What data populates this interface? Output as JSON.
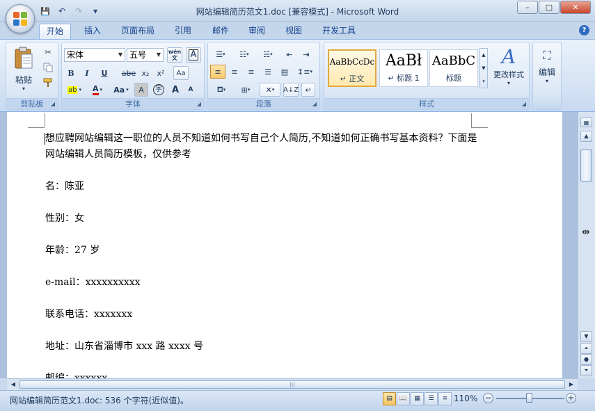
{
  "window": {
    "title": "网站编辑简历范文1.doc [兼容模式] - Microsoft Word",
    "minimize": "–",
    "maximize": "□",
    "close": "✕"
  },
  "qat": {
    "save": "💾",
    "undo": "↶",
    "redo": "↷",
    "customize": "▾"
  },
  "tabs": [
    "开始",
    "插入",
    "页面布局",
    "引用",
    "邮件",
    "审阅",
    "视图",
    "开发工具"
  ],
  "help": "?",
  "ribbon": {
    "clipboard": {
      "label": "剪贴板",
      "paste": "粘贴",
      "paste_arrow": "▾"
    },
    "font": {
      "label": "字体",
      "font_name": "宋体",
      "font_size": "五号",
      "wen_btn": "wén\n文",
      "A_btn": "A",
      "bold": "B",
      "italic": "I",
      "underline": "U",
      "strike": "abe",
      "subscript": "x₂",
      "superscript": "x²",
      "clear": "Aa",
      "highlight": "ab",
      "font_color": "A",
      "change_case": "Aa",
      "char_shade": "A",
      "enclose": "字",
      "grow": "A",
      "shrink": "A"
    },
    "paragraph": {
      "label": "段落"
    },
    "styles": {
      "label": "样式",
      "items": [
        {
          "sample": "AaBbCcDc",
          "name": "↵ 正文"
        },
        {
          "sample": "AaBł",
          "name": "↵ 标题 1"
        },
        {
          "sample": "AaBbC",
          "name": "标题"
        }
      ],
      "change_styles": "更改样式"
    },
    "editing": {
      "label": "编辑"
    }
  },
  "document": {
    "lines": [
      "想应聘网站编辑这一职位的人员不知道如何书写自己个人简历,不知道如何正确书写基本资料？下面是网站编辑人员简历模板，仅供参考",
      "",
      "名：陈亚",
      "",
      "性别：女",
      "",
      "年龄：27 岁",
      "",
      "e-mail：xxxxxxxxxx",
      "",
      "联系电话：xxxxxxx",
      "",
      "地址：山东省淄博市 xxx 路 xxxx 号",
      "",
      "邮编：xxxxxx"
    ]
  },
  "status": {
    "text": "网站编辑简历范文1.doc: 536 个字符(近似值)。",
    "zoom": "110%",
    "zoom_minus": "−",
    "zoom_plus": "+"
  }
}
